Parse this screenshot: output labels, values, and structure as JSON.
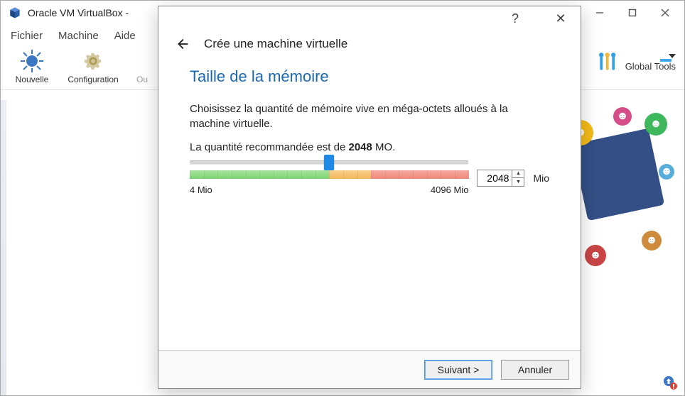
{
  "main_window": {
    "title": "Oracle VM VirtualBox -",
    "menu": {
      "file": "Fichier",
      "machine": "Machine",
      "help": "Aide"
    },
    "toolbar": {
      "new": "Nouvelle",
      "settings": "Configuration",
      "out": "Ou",
      "global_tools": "Global Tools"
    }
  },
  "wizard": {
    "help_symbol": "?",
    "close_symbol": "✕",
    "title": "Crée une machine virtuelle",
    "heading": "Taille de la mémoire",
    "description": "Choisissez la quantité de mémoire vive en méga-octets alloués à la machine virtuelle.",
    "recommend_prefix": "La quantité recommandée est de ",
    "recommend_value": "2048",
    "recommend_suffix": " MO.",
    "slider": {
      "min_label": "4 Mio",
      "max_label": "4096 Mio",
      "min": 4,
      "max": 4096,
      "value": 2048,
      "unit": "Mio"
    },
    "buttons": {
      "next": "Suivant >",
      "cancel": "Annuler"
    }
  }
}
